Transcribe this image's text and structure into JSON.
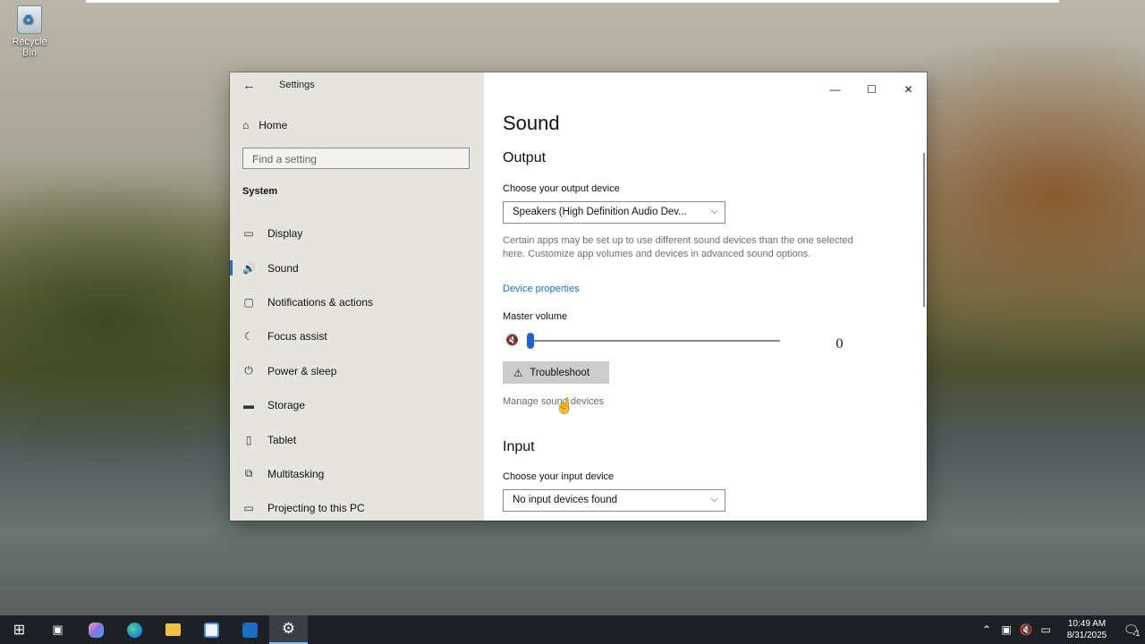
{
  "desktop": {
    "recycle_bin_label": "Recycle Bin"
  },
  "window": {
    "title": "Settings",
    "back_glyph": "←",
    "minimize_glyph": "—",
    "maximize_glyph": "☐",
    "close_glyph": "✕"
  },
  "nav": {
    "home_label": "Home",
    "search_placeholder": "Find a setting",
    "section_label": "System",
    "items": [
      {
        "label": "Display",
        "icon": "display-icon",
        "glyph": "▭"
      },
      {
        "label": "Sound",
        "icon": "speaker-icon",
        "glyph": "🔊"
      },
      {
        "label": "Notifications & actions",
        "icon": "notification-icon",
        "glyph": "▢"
      },
      {
        "label": "Focus assist",
        "icon": "moon-icon",
        "glyph": "☾"
      },
      {
        "label": "Power & sleep",
        "icon": "power-icon",
        "glyph": "⏻"
      },
      {
        "label": "Storage",
        "icon": "storage-icon",
        "glyph": "▬"
      },
      {
        "label": "Tablet",
        "icon": "tablet-icon",
        "glyph": "▯"
      },
      {
        "label": "Multitasking",
        "icon": "multitasking-icon",
        "glyph": "⧉"
      },
      {
        "label": "Projecting to this PC",
        "icon": "projecting-icon",
        "glyph": "▭"
      }
    ],
    "active_index": 1
  },
  "content": {
    "page_title": "Sound",
    "output_heading": "Output",
    "output_device_label": "Choose your output device",
    "output_device_value": "Speakers (High Definition Audio Dev...",
    "info_text": "Certain apps may be set up to use different sound devices than the one selected here. Customize app volumes and devices in advanced sound options.",
    "device_properties_link": "Device properties",
    "master_volume_label": "Master volume",
    "volume_value": "0",
    "volume_level": 0,
    "troubleshoot_label": "Troubleshoot",
    "manage_devices_link": "Manage sound devices",
    "input_heading": "Input",
    "input_device_label": "Choose your input device",
    "input_device_value": "No input devices found"
  },
  "taskbar": {
    "apps": [
      {
        "name": "start-button",
        "glyph": "⊞"
      },
      {
        "name": "task-view-button",
        "glyph": "▣"
      },
      {
        "name": "copilot-icon",
        "color": "#c97bd8"
      },
      {
        "name": "edge-icon",
        "color": "#1f8fd6"
      },
      {
        "name": "file-explorer-icon",
        "color": "#f3c23c"
      },
      {
        "name": "store-icon",
        "color": "#4a8fe0"
      },
      {
        "name": "outlook-icon",
        "color": "#1a6fc4"
      },
      {
        "name": "settings-icon",
        "glyph": "⚙"
      }
    ],
    "time": "10:49 AM",
    "date": "8/31/2025",
    "notification_count": "1"
  },
  "colors": {
    "accent": "#1e64c8",
    "link": "#1a73c8",
    "nav_bg": "#e6e4df"
  }
}
